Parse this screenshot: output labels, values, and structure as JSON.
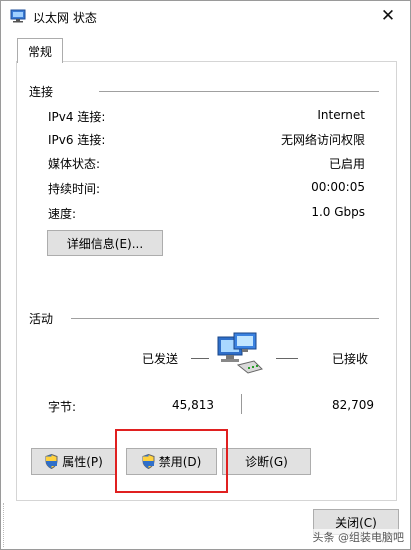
{
  "window": {
    "title": "以太网 状态",
    "close_glyph": "✕"
  },
  "tabs": [
    {
      "label": "常规"
    }
  ],
  "connection": {
    "group_label": "连接",
    "rows": [
      {
        "label": "IPv4 连接:",
        "value": "Internet"
      },
      {
        "label": "IPv6 连接:",
        "value": "无网络访问权限"
      },
      {
        "label": "媒体状态:",
        "value": "已启用"
      },
      {
        "label": "持续时间:",
        "value": "00:00:05"
      },
      {
        "label": "速度:",
        "value": "1.0 Gbps"
      }
    ],
    "details_button": "详细信息(E)..."
  },
  "activity": {
    "group_label": "活动",
    "sent_label": "已发送",
    "received_label": "已接收",
    "bytes_label": "字节:",
    "bytes_sent": "45,813",
    "bytes_received": "82,709"
  },
  "buttons": {
    "properties": "属性(P)",
    "disable": "禁用(D)",
    "diagnose": "诊断(G)",
    "close": "关闭(C)"
  },
  "watermark": "头条 @组装电脑吧",
  "icons": {
    "title": "network-adapter-icon",
    "activity": "network-computers-icon",
    "shield": "uac-shield-icon"
  },
  "colors": {
    "highlight": "#e02020",
    "button_bg": "#e1e1e1"
  }
}
